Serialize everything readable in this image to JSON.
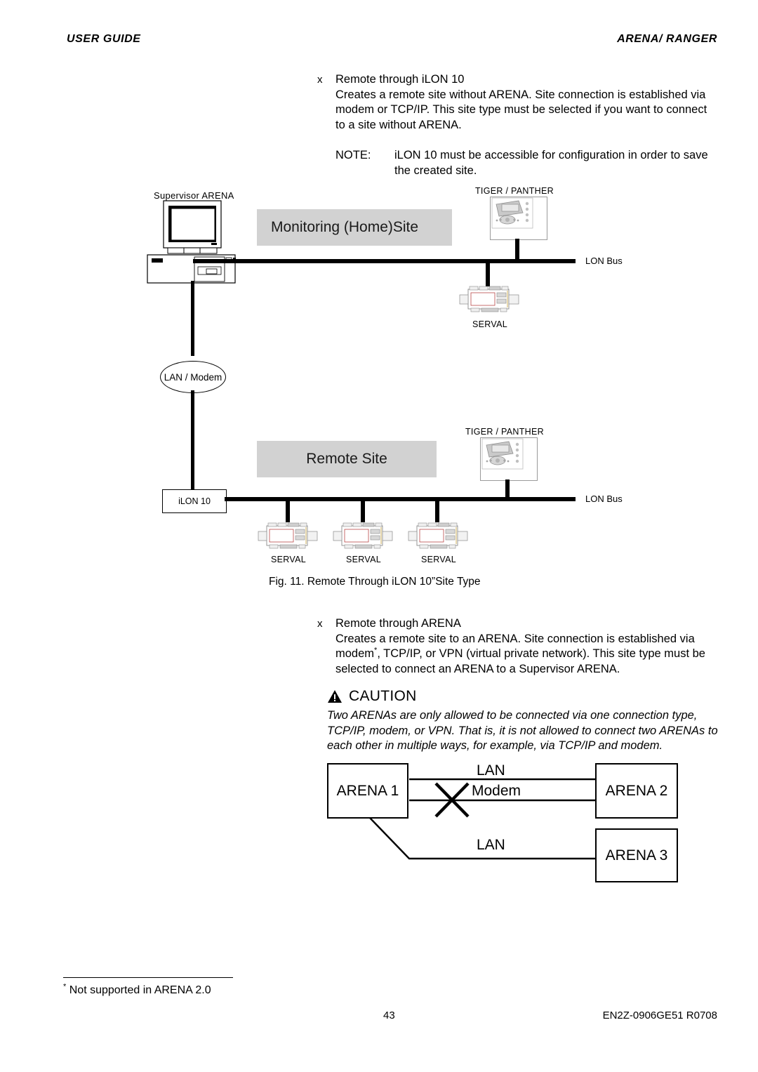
{
  "header": {
    "left": "USER GUIDE",
    "right": "ARENA/ RANGER"
  },
  "section_ilon": {
    "bullet_mark": "x",
    "heading": "Remote through iLON 10",
    "body": "Creates a remote site without ARENA. Site connection is established via modem or TCP/IP. This site type must be selected if you want to connect to a site without ARENA.",
    "note_label": "NOTE:",
    "note_text": "iLON 10 must be accessible for configuration in order to save the created site."
  },
  "figure": {
    "caption": "Fig. 11.  Remote Through iLON 10”Site Type",
    "monitoring_site_label": "Monitoring (Home)Site",
    "remote_site_label": "Remote Site",
    "supervisor_label": "Supervisor ARENA",
    "lan_modem_label": "LAN / Modem",
    "ilon_label": "iLON 10",
    "lon_bus_label_top": "LON Bus",
    "lon_bus_label_bottom": "LON Bus",
    "tiger_label_top": "TIGER / PANTHER",
    "tiger_label_bottom": "TIGER / PANTHER",
    "serval_top": "SERVAL",
    "servals_bottom": [
      "SERVAL",
      "SERVAL",
      "SERVAL"
    ]
  },
  "section_arena": {
    "bullet_mark": "x",
    "heading": "Remote through ARENA",
    "body_1": "Creates a remote site to an ARENA. Site connection is established via",
    "body_2_pre": "modem",
    "body_2_sup": "*",
    "body_2_post": ", TCP/IP, or VPN (virtual private network). This site type must be",
    "body_3": "selected to connect an ARENA to a Supervisor ARENA."
  },
  "caution": {
    "title": "CAUTION",
    "body": "Two ARENAs are only allowed to be connected via one connection type, TCP/IP, modem, or VPN. That is, it is not allowed to connect two ARENAs to each other in multiple ways, for example, via TCP/IP and  modem."
  },
  "arena_diagram": {
    "node_1": "ARENA 1",
    "node_2": "ARENA 2",
    "node_3": "ARENA 3",
    "link_lan_top": "LAN",
    "link_modem": "Modem",
    "link_lan_bottom": "LAN"
  },
  "footer": {
    "footnote_marker": "*",
    "footnote": "Not supported in ARENA 2.0",
    "page_number": "43",
    "doc_code": "EN2Z-0906GE51 R0708"
  },
  "colors": {
    "shade": "#d2d2d2",
    "ink": "#000000",
    "device_gray": "#c9c9c9"
  }
}
